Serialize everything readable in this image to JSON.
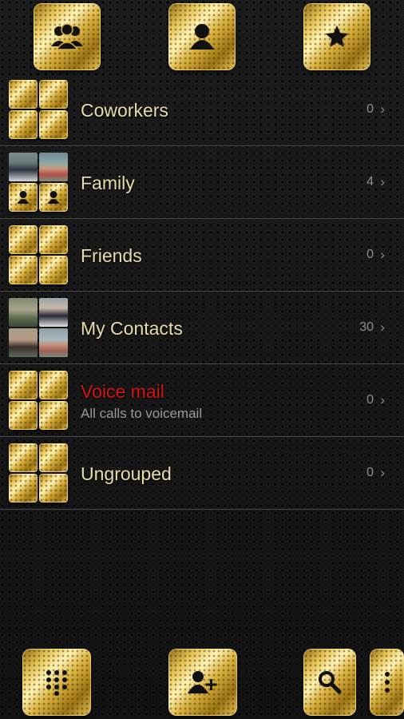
{
  "toolbar_top": [
    {
      "name": "groups-tab",
      "icon": "groups-icon"
    },
    {
      "name": "contacts-tab",
      "icon": "person-icon"
    },
    {
      "name": "favorites-tab",
      "icon": "star-icon"
    }
  ],
  "groups": [
    {
      "label": "Coworkers",
      "count": "0",
      "chevron": "›",
      "thumb": "placeholder"
    },
    {
      "label": "Family",
      "count": "4",
      "chevron": "›",
      "thumb": "mixed"
    },
    {
      "label": "Friends",
      "count": "0",
      "chevron": "›",
      "thumb": "placeholder"
    },
    {
      "label": "My Contacts",
      "count": "30",
      "chevron": "›",
      "thumb": "photos"
    },
    {
      "label": "Voice mail",
      "sublabel": "All calls to voicemail",
      "count": "0",
      "chevron": "›",
      "thumb": "placeholder",
      "label_color": "#d21515"
    },
    {
      "label": "Ungrouped",
      "count": "0",
      "chevron": "›",
      "thumb": "placeholder"
    }
  ],
  "toolbar_bottom": [
    {
      "name": "dialpad-button",
      "icon": "dialpad-icon"
    },
    {
      "name": "add-contact-button",
      "icon": "add-person-icon"
    },
    {
      "name": "search-button",
      "icon": "search-icon"
    },
    {
      "name": "overflow-menu-button",
      "icon": "more-vert-icon"
    }
  ],
  "colors": {
    "accent_gold": "#d8b13f",
    "label_text": "#e8dcab",
    "voicemail_red": "#d21515",
    "count_text": "#8f8f8f"
  }
}
